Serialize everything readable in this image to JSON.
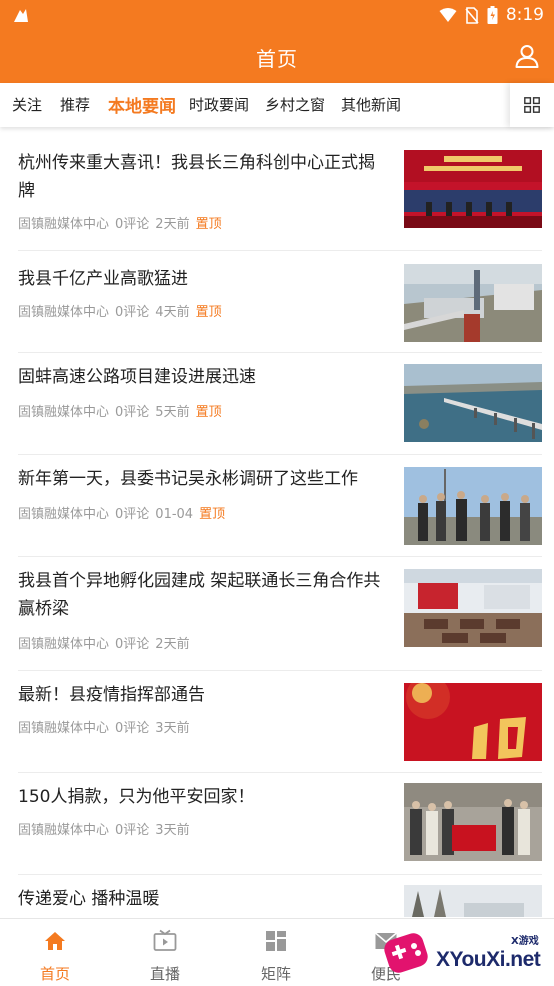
{
  "status_bar": {
    "time": "8:19",
    "icons": [
      "app-notification-icon",
      "wifi-icon",
      "no-sim-icon",
      "battery-icon"
    ]
  },
  "app_bar": {
    "title": "首页",
    "user_icon": "user-icon"
  },
  "colors": {
    "accent": "#f47a20",
    "meta": "#9a9a9a",
    "text": "#222222"
  },
  "tabs": [
    {
      "label": "关注",
      "active": false
    },
    {
      "label": "推荐",
      "active": false
    },
    {
      "label": "本地要闻",
      "active": true
    },
    {
      "label": "时政要闻",
      "active": false
    },
    {
      "label": "乡村之窗",
      "active": false
    },
    {
      "label": "其他新闻",
      "active": false
    }
  ],
  "news": [
    {
      "title": "杭州传来重大喜讯！我县长三角科创中心正式揭牌",
      "source": "固镇融媒体中心",
      "comments": "0评论",
      "time": "2天前",
      "pinned": "置顶",
      "thumb": "ceremony-stage"
    },
    {
      "title": "我县千亿产业高歌猛进",
      "source": "固镇融媒体中心",
      "comments": "0评论",
      "time": "4天前",
      "pinned": "置顶",
      "thumb": "industrial-plant"
    },
    {
      "title": "固蚌高速公路项目建设进展迅速",
      "source": "固镇融媒体中心",
      "comments": "0评论",
      "time": "5天前",
      "pinned": "置顶",
      "thumb": "bridge-water"
    },
    {
      "title": "新年第一天，县委书记吴永彬调研了这些工作",
      "source": "固镇融媒体中心",
      "comments": "0评论",
      "time": "01-04",
      "pinned": "置顶",
      "thumb": "people-outdoor"
    },
    {
      "title": "我县首个异地孵化园建成 架起联通长三角合作共赢桥梁",
      "source": "固镇融媒体中心",
      "comments": "0评论",
      "time": "2天前",
      "pinned": "",
      "thumb": "meeting-hall"
    },
    {
      "title": "最新！县疫情指挥部通告",
      "source": "固镇融媒体中心",
      "comments": "0评论",
      "time": "3天前",
      "pinned": "",
      "thumb": "red-notice"
    },
    {
      "title": "150人捐款，只为他平安回家！",
      "source": "固镇融媒体中心",
      "comments": "0评论",
      "time": "3天前",
      "pinned": "",
      "thumb": "volunteers-group"
    },
    {
      "title": "传递爱心 播种温暖",
      "source": "",
      "comments": "",
      "time": "",
      "pinned": "",
      "thumb": "winter-street"
    }
  ],
  "bottom_nav": [
    {
      "label": "首页",
      "icon": "home-icon",
      "active": true
    },
    {
      "label": "直播",
      "icon": "tv-icon",
      "active": false
    },
    {
      "label": "矩阵",
      "icon": "matrix-icon",
      "active": false
    },
    {
      "label": "便民",
      "icon": "mail-icon",
      "active": false
    }
  ],
  "watermark": {
    "text": "XYouXi.net",
    "small": "X游戏"
  }
}
